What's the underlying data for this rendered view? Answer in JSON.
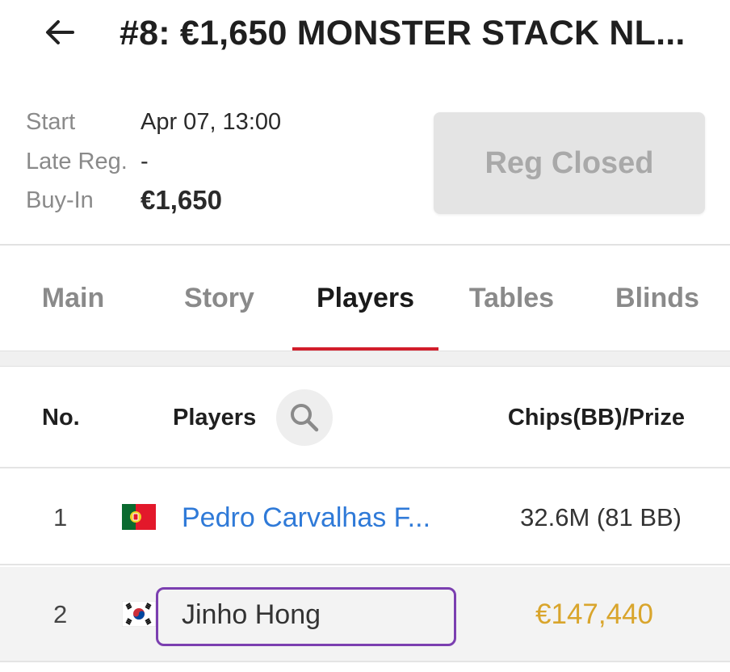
{
  "header": {
    "back_icon": "arrow-left-icon",
    "title": "#8: €1,650 MONSTER STACK NL..."
  },
  "info": {
    "start_label": "Start",
    "start_value": "Apr 07, 13:00",
    "late_reg_label": "Late Reg.",
    "late_reg_value": "-",
    "buyin_label": "Buy-In",
    "buyin_value": "€1,650",
    "reg_button": "Reg Closed"
  },
  "tabs": [
    {
      "label": "Main",
      "active": false
    },
    {
      "label": "Story",
      "active": false
    },
    {
      "label": "Players",
      "active": true
    },
    {
      "label": "Tables",
      "active": false
    },
    {
      "label": "Blinds",
      "active": false
    }
  ],
  "table": {
    "col_no": "No.",
    "col_players": "Players",
    "search_icon": "search-icon",
    "col_chips": "Chips(BB)/Prize",
    "rows": [
      {
        "no": "1",
        "flag": "portugal-flag-icon",
        "name": "Pedro Carvalhas F...",
        "value": "32.6M  (81 BB)"
      },
      {
        "no": "2",
        "flag": "south-korea-flag-icon",
        "name": "Jinho Hong",
        "value": "€147,440"
      }
    ]
  },
  "colors": {
    "accent_red": "#d21d2a",
    "link_blue": "#2f7ad8",
    "prize_gold": "#d9a52c",
    "highlight_purple": "#7b3fb0"
  }
}
